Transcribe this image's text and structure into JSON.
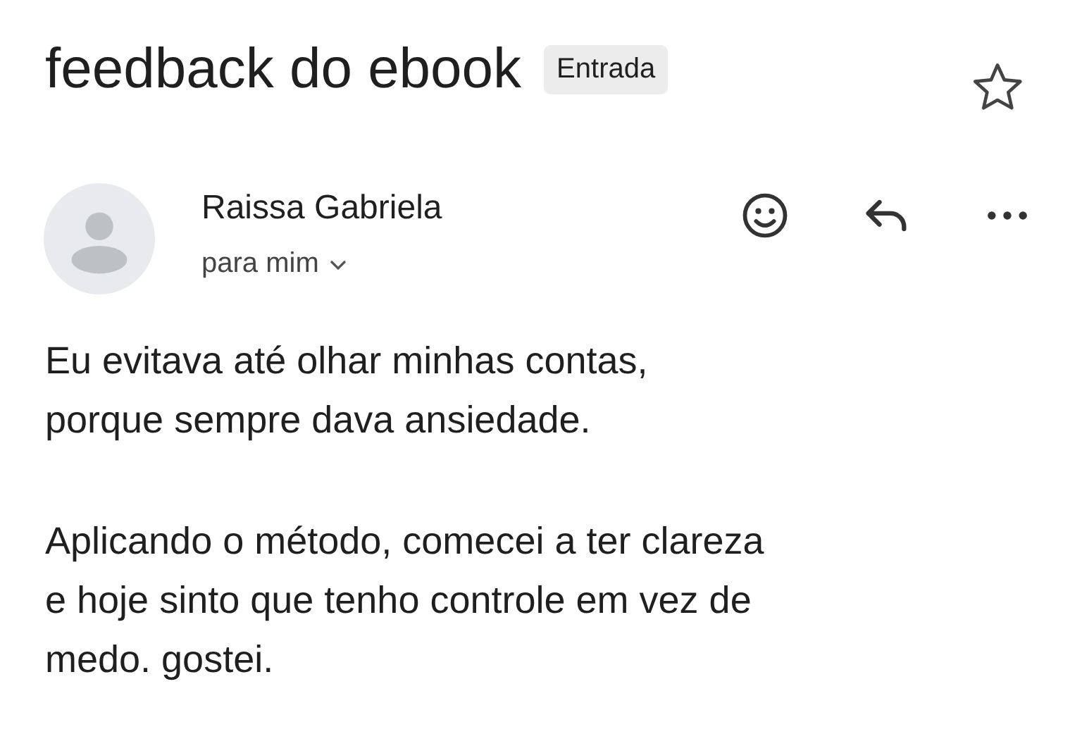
{
  "subject": {
    "title": "feedback do ebook",
    "label": "Entrada",
    "starred": false
  },
  "message": {
    "sender": "Raissa Gabriela",
    "recipient": "para mim",
    "paragraphs": [
      "Eu evitava até olhar minhas contas,\nporque sempre dava ansiedade.",
      "Aplicando o método, comecei a ter clareza\ne hoje sinto que tenho controle em vez de\nmedo. gostei."
    ]
  }
}
